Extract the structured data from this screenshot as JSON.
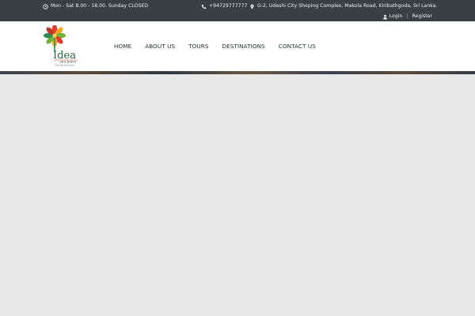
{
  "topbar": {
    "hours": "Mon - Sat 8.00 - 18.00. Sunday CLOSED",
    "phone": "+94729777777",
    "address": "G-2, Udeshi City Shoping Complex, Makola Road, Kiribathgoda, Sri Lanka.",
    "login": "Login",
    "separator": "|",
    "register": "Register",
    "icons": [
      "clock-icon",
      "phone-icon",
      "map-pin-icon",
      "user-icon"
    ]
  },
  "logo": {
    "word": "Idea",
    "sub": "HOLIDAYS",
    "tagline": "The World is Yours",
    "colors": [
      "#e23b2e",
      "#f5a623",
      "#6fb33b",
      "#2e8b57"
    ]
  },
  "nav": {
    "items": [
      "HOME",
      "ABOUT US",
      "TOURS",
      "DESTINATIONS",
      "CONTACT US"
    ]
  }
}
